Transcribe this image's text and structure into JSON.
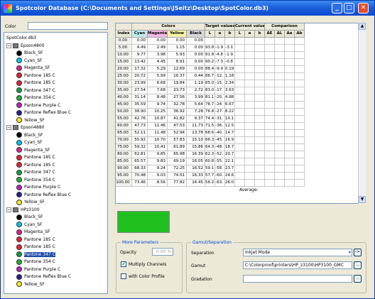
{
  "window": {
    "title": "Spotcolor Database (C:\\Documents and Settings\\JSeitz\\Desktop\\SpotColor.db3)"
  },
  "left": {
    "color_label": "Color",
    "color_value": "",
    "tree": [
      {
        "t": "root",
        "label": "SpotColor.db3"
      },
      {
        "t": "group",
        "label": "Epson4800"
      },
      {
        "t": "item",
        "label": "Black_SF",
        "c": "#000000"
      },
      {
        "t": "item",
        "label": "Cyan_SF",
        "c": "#00c8f0"
      },
      {
        "t": "item",
        "label": "Magenta_SF",
        "c": "#e0208c"
      },
      {
        "t": "item",
        "label": "Pantone 185 C",
        "c": "#e82030"
      },
      {
        "t": "item",
        "label": "Pantone 185 C",
        "c": "#e82030"
      },
      {
        "t": "item",
        "label": "Pantone 347 C",
        "c": "#10a040"
      },
      {
        "t": "item",
        "label": "Pantone 354 C",
        "c": "#20b030"
      },
      {
        "t": "item",
        "label": "Pantone Purple C",
        "c": "#c020c0"
      },
      {
        "t": "item",
        "label": "Pantone Reflex Blue C",
        "c": "#202090"
      },
      {
        "t": "item",
        "label": "Yellow_SF",
        "c": "#f8e820"
      },
      {
        "t": "group",
        "label": "Epson4880"
      },
      {
        "t": "item",
        "label": "Black_SF",
        "c": "#000000"
      },
      {
        "t": "item",
        "label": "Cyan_SF",
        "c": "#00c8f0"
      },
      {
        "t": "item",
        "label": "Magenta_SF",
        "c": "#e0208c"
      },
      {
        "t": "item",
        "label": "Pantone 185 C",
        "c": "#e82030"
      },
      {
        "t": "item",
        "label": "Pantone 185 C",
        "c": "#e82030"
      },
      {
        "t": "item",
        "label": "Pantone 347 C",
        "c": "#10a040"
      },
      {
        "t": "item",
        "label": "Pantone 354 C",
        "c": "#20b030"
      },
      {
        "t": "item",
        "label": "Pantone Purple C",
        "c": "#c020c0"
      },
      {
        "t": "item",
        "label": "Pantone Reflex Blue C",
        "c": "#202090"
      },
      {
        "t": "item",
        "label": "Yellow_SF",
        "c": "#f8e820"
      },
      {
        "t": "group",
        "label": "HPz3100"
      },
      {
        "t": "item",
        "label": "Black_SF",
        "c": "#000000"
      },
      {
        "t": "item",
        "label": "Cyan_SF",
        "c": "#00c8f0"
      },
      {
        "t": "item",
        "label": "Magenta_SF",
        "c": "#e0208c"
      },
      {
        "t": "item",
        "label": "Pantone 185 C",
        "c": "#e82030"
      },
      {
        "t": "item",
        "label": "Pantone 185 C",
        "c": "#e82030"
      },
      {
        "t": "item",
        "label": "Pantone 347 C",
        "c": "#10a040",
        "selected": true
      },
      {
        "t": "item",
        "label": "Pantone 354 C",
        "c": "#20b030"
      },
      {
        "t": "item",
        "label": "Pantone Purple C",
        "c": "#c020c0"
      },
      {
        "t": "item",
        "label": "Pantone Reflex Blue C",
        "c": "#202090"
      },
      {
        "t": "item",
        "label": "Yellow_SF",
        "c": "#f8e820"
      }
    ]
  },
  "table": {
    "groups": [
      "Colors",
      "Target values",
      "Current value",
      "Comparison"
    ],
    "headers": [
      "Index",
      "Cyan",
      "Magenta",
      "Yellow",
      "Black",
      "L",
      "a",
      "b",
      "L",
      "a",
      "b",
      "ΔE",
      "ΔL",
      "Δa",
      "Δb"
    ],
    "rows": [
      [
        "0.00",
        "0.00",
        "0.00",
        "0.00",
        "0.00",
        "",
        "",
        "",
        "",
        "",
        "",
        "",
        "",
        "",
        ""
      ],
      [
        "5.00",
        "4.49",
        "2.49",
        "1.15",
        "0.00",
        "93.8",
        "-1.9",
        "-3.1",
        "",
        "",
        "",
        "",
        "",
        "",
        ""
      ],
      [
        "10.00",
        "9.77",
        "3.98",
        "5.93",
        "0.00",
        "91.8",
        "-4.8",
        "-1.9",
        "",
        "",
        "",
        "",
        "",
        "",
        ""
      ],
      [
        "15.00",
        "13.42",
        "4.45",
        "8.91",
        "0.00",
        "90.2",
        "-7.3",
        "-0.8",
        "",
        "",
        "",
        "",
        "",
        "",
        ""
      ],
      [
        "20.00",
        "17.32",
        "5.29",
        "12.69",
        "0.00",
        "88.4",
        "-9.9",
        "0.19",
        "",
        "",
        "",
        "",
        "",
        "",
        ""
      ],
      [
        "25.00",
        "20.72",
        "5.99",
        "16.37",
        "0.44",
        "86.7",
        "-12.",
        "1.18",
        "",
        "",
        "",
        "",
        "",
        "",
        ""
      ],
      [
        "30.00",
        "23.99",
        "6.68",
        "19.84",
        "1.19",
        "85.0",
        "-15.",
        "2.34",
        "",
        "",
        "",
        "",
        "",
        "",
        ""
      ],
      [
        "35.00",
        "27.54",
        "7.68",
        "23.73",
        "2.72",
        "83.0",
        "-17.",
        "3.63",
        "",
        "",
        "",
        "",
        "",
        "",
        ""
      ],
      [
        "40.00",
        "31.14",
        "8.48",
        "27.56",
        "3.99",
        "81.1",
        "-20.",
        "4.88",
        "",
        "",
        "",
        "",
        "",
        "",
        ""
      ],
      [
        "45.00",
        "35.59",
        "9.74",
        "32.78",
        "5.64",
        "78.7",
        "-24.",
        "6.67",
        "",
        "",
        "",
        "",
        "",
        "",
        ""
      ],
      [
        "50.00",
        "38.90",
        "10.25",
        "36.92",
        "7.28",
        "76.8",
        "-27.",
        "8.22",
        "",
        "",
        "",
        "",
        "",
        "",
        ""
      ],
      [
        "55.00",
        "42.76",
        "10.87",
        "41.82",
        "9.37",
        "74.4",
        "-31.",
        "10.1",
        "",
        "",
        "",
        "",
        "",
        "",
        ""
      ],
      [
        "60.00",
        "47.73",
        "11.46",
        "47.53",
        "11.73",
        "71.5",
        "-36.",
        "12.5",
        "",
        "",
        "",
        "",
        "",
        "",
        ""
      ],
      [
        "65.00",
        "52.11",
        "11.48",
        "52.94",
        "13.78",
        "68.6",
        "-40.",
        "14.7",
        "",
        "",
        "",
        "",
        "",
        "",
        ""
      ],
      [
        "70.00",
        "55.92",
        "10.70",
        "57.83",
        "15.10",
        "66.3",
        "-45.",
        "16.9",
        "",
        "",
        "",
        "",
        "",
        "",
        ""
      ],
      [
        "75.00",
        "59.32",
        "10.41",
        "61.89",
        "15.86",
        "64.3",
        "-48.",
        "18.7",
        "",
        "",
        "",
        "",
        "",
        "",
        ""
      ],
      [
        "80.00",
        "62.81",
        "9.85",
        "65.98",
        "16.39",
        "62.3",
        "-52.",
        "20.7",
        "",
        "",
        "",
        "",
        "",
        "",
        ""
      ],
      [
        "85.00",
        "65.57",
        "9.83",
        "69.19",
        "16.05",
        "60.8",
        "-55.",
        "22.1",
        "",
        "",
        "",
        "",
        "",
        "",
        ""
      ],
      [
        "90.00",
        "68.33",
        "9.24",
        "72.25",
        "16.52",
        "59.1",
        "-58.",
        "23.7",
        "",
        "",
        "",
        "",
        "",
        "",
        ""
      ],
      [
        "95.00",
        "70.48",
        "9.03",
        "74.51",
        "16.33",
        "57.7",
        "-60.",
        "24.6",
        "",
        "",
        "",
        "",
        "",
        "",
        ""
      ],
      [
        "100.00",
        "73.46",
        "8.56",
        "77.82",
        "16.45",
        "56.2",
        "-63.",
        "26.0",
        "",
        "",
        "",
        "",
        "",
        "",
        ""
      ]
    ],
    "average_label": "Average:"
  },
  "more_params": {
    "title": "More Parameters",
    "opacity_label": "Opacity",
    "opacity_value": "0.00 %",
    "multiply_label": "Multiply Channels",
    "multiply_checked": true,
    "profile_label": "with Color Profile",
    "profile_checked": false
  },
  "gamut": {
    "title": "Gamut/Separation",
    "separation_label": "Separation",
    "separation_value": "Inkjet Mode",
    "gamut_label": "Gamut",
    "gamut_value": "C:\\Colorproof\\printers\\HP_z3100\\HP3100_GMC",
    "gradation_label": "Gradation",
    "gradation_value": "",
    "arrow_btn": "->",
    "browse_btn": "..."
  },
  "preview_color": "#20c020"
}
